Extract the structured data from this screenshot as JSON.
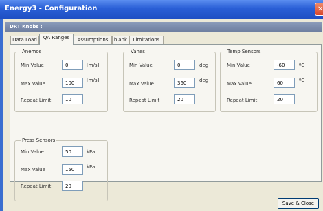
{
  "window": {
    "title": "Energy3 - Configuration",
    "close_glyph": "✕"
  },
  "header": {
    "section_label": "DRT Knobs :"
  },
  "tabs": [
    {
      "label": "Data Load",
      "active": false
    },
    {
      "label": "QA Ranges",
      "active": true
    },
    {
      "label": "Assumptions",
      "active": false
    },
    {
      "label": "blank",
      "active": false
    },
    {
      "label": "Limitations",
      "active": false
    }
  ],
  "groups": {
    "anemos": {
      "title": "Anemos",
      "min_label": "Min Value",
      "min_value": "0",
      "min_unit": "[m/s]",
      "max_label": "Max Value",
      "max_value": "100",
      "max_unit": "[m/s]",
      "repeat_label": "Repeat Limit",
      "repeat_value": "10"
    },
    "vanes": {
      "title": "Vanes",
      "min_label": "Min Value",
      "min_value": "0",
      "min_unit": "deg",
      "max_label": "Max Value",
      "max_value": "360",
      "max_unit": "deg",
      "repeat_label": "Repeat Limit",
      "repeat_value": "20"
    },
    "temp": {
      "title": "Temp Sensors",
      "min_label": "Min Value",
      "min_value": "-60",
      "min_unit": "ºC",
      "max_label": "Max Value",
      "max_value": "60",
      "max_unit": "ºC",
      "repeat_label": "Repeat Limit",
      "repeat_value": "20"
    },
    "press": {
      "title": "Press Sensors",
      "min_label": "Min Value",
      "min_value": "50",
      "min_unit": "kPa",
      "max_label": "Max Value",
      "max_value": "150",
      "max_unit": "kPa",
      "repeat_label": "Repeat Limit",
      "repeat_value": "20"
    }
  },
  "footer": {
    "save_close_label": "Save & Close"
  },
  "colors": {
    "titlebar": "#2a5fd6",
    "face": "#ece9d8",
    "panel": "#f7f6f1",
    "input_border": "#7f9db9"
  }
}
